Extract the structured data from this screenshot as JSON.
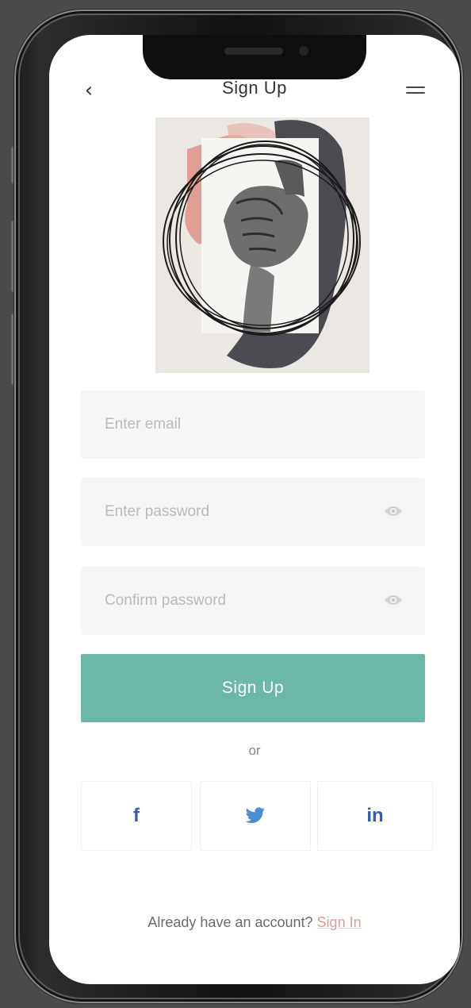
{
  "header": {
    "back_icon": "chevron-left-icon",
    "back_glyph": "‹",
    "title": "Sign Up",
    "menu_icon": "menu-icon"
  },
  "hero": {
    "icon": "handshake-illustration",
    "colors": {
      "background": "#ebe8e3",
      "salmon": "#e09a90",
      "charcoal": "#3c3e45",
      "ring": "#1a1a1a"
    }
  },
  "form": {
    "email_placeholder": "Enter email",
    "password_placeholder": "Enter password",
    "confirm_placeholder": "Confirm password",
    "eye_icon": "eye-icon",
    "submit_label": "Sign Up"
  },
  "divider": {
    "text": "or"
  },
  "social": {
    "facebook_label": "f",
    "twitter_icon": "twitter-bird-icon",
    "linkedin_label": "in"
  },
  "footer": {
    "prompt": "Already have an account? ",
    "link": "Sign In"
  },
  "colors": {
    "accent": "#6bb8a8",
    "link": "#e29b8f",
    "field_bg": "#f6f6f6",
    "facebook": "#3b5bb3",
    "twitter": "#4a8fd6",
    "linkedin": "#2d5fb0"
  }
}
